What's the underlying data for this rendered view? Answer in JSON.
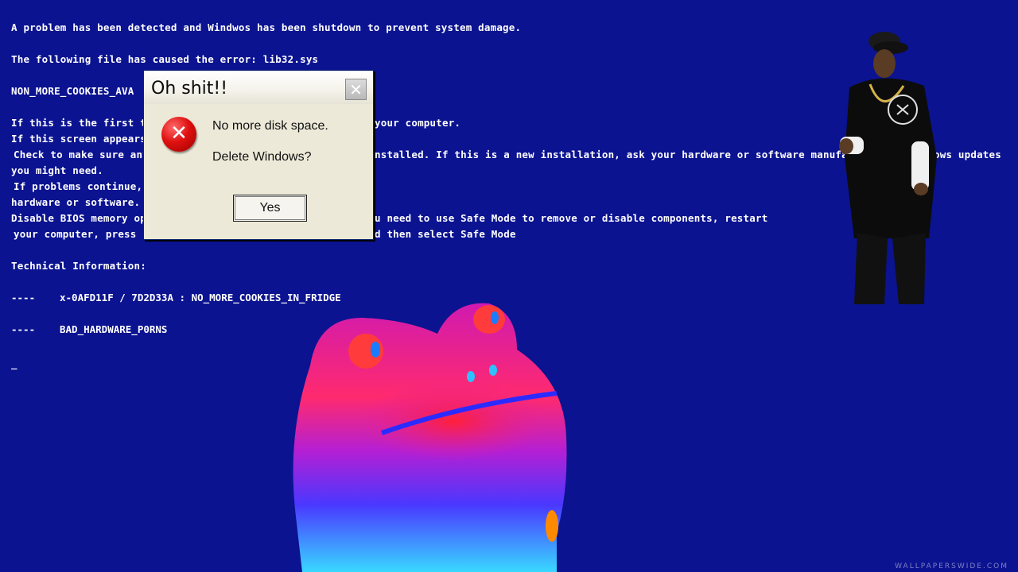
{
  "bsod": {
    "line1": "A problem has been detected and Windwos has been shutdown to prevent system damage.",
    "line2": "The following file has caused the error: lib32.sys",
    "line3": "NON_MORE_COOKIES_AVA",
    "line4a": "If this is the first tim",
    "line4b": "your computer.",
    "line5": "If this screen appears",
    "line6a": "Check to make sure any",
    "line6b": "nstalled. If this is a new installation, ask your hardware or software manufactur",
    "line6c": "ows updates",
    "line7": "you might need.",
    "line8": "If problems continue, c",
    "line9": "hardware or software.",
    "line10a": "Disable BIOS memory op",
    "line10b": "u need to use Safe Mode to remove or disable components, restart",
    "line11a": "your computer, press F",
    "line11b": "d then select Safe Mode",
    "tech_header": "Technical Information:",
    "dash": "----",
    "tech1": "x-0AFD11F / 7D2D33A : NO_MORE_COOKIES_IN_FRIDGE",
    "tech2": "BAD_HARDWARE_P0RNS",
    "cursor": "_"
  },
  "dialog": {
    "title": "Oh shit!!",
    "close_glyph": "✕",
    "message1": "No more disk space.",
    "message2": "Delete Windows?",
    "yes_label": "Yes",
    "icon": "error-icon"
  },
  "watermark": "WALLPAPERSWIDE.COM",
  "colors": {
    "background": "#0b1390",
    "text": "#ffffff",
    "dialog_face": "#ece9d8"
  }
}
